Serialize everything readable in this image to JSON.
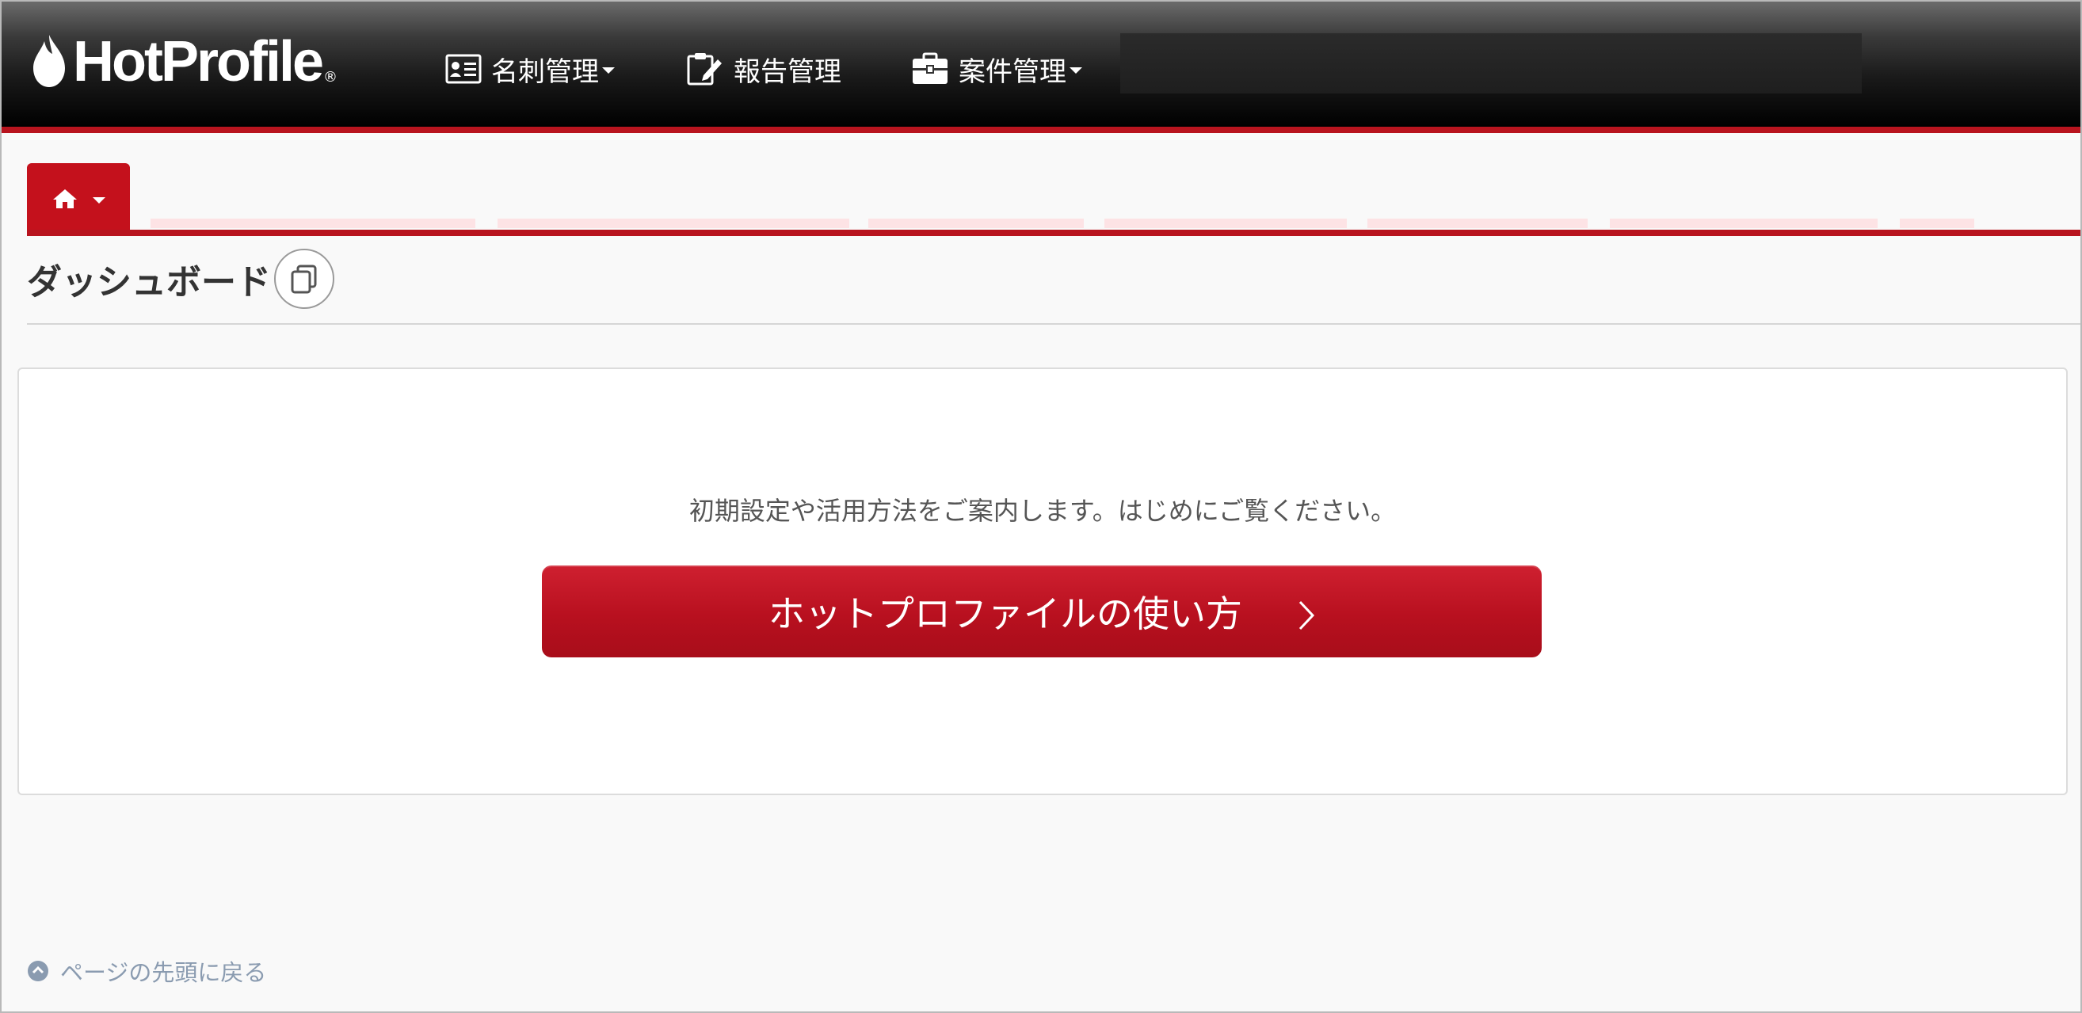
{
  "app": {
    "logo_text": "HotProfile",
    "logo_reg": "®"
  },
  "nav": {
    "items": [
      {
        "label": "名刺管理",
        "icon": "business-card-icon",
        "has_dropdown": true
      },
      {
        "label": "報告管理",
        "icon": "report-edit-icon",
        "has_dropdown": false
      },
      {
        "label": "案件管理",
        "icon": "briefcase-icon",
        "has_dropdown": true
      }
    ]
  },
  "tabs": {
    "home_icon": "home-icon"
  },
  "page": {
    "title": "ダッシュボード"
  },
  "panel": {
    "intro": "初期設定や活用方法をご案内します。はじめにご覧ください。",
    "guide_button": "ホットプロファイルの使い方"
  },
  "footer": {
    "back_to_top": "ページの先頭に戻る"
  },
  "colors": {
    "brand_red": "#b8141e",
    "button_red": "#c4111c",
    "nav_dark": "#1a1a1a",
    "link_gray": "#8a9bb0"
  }
}
